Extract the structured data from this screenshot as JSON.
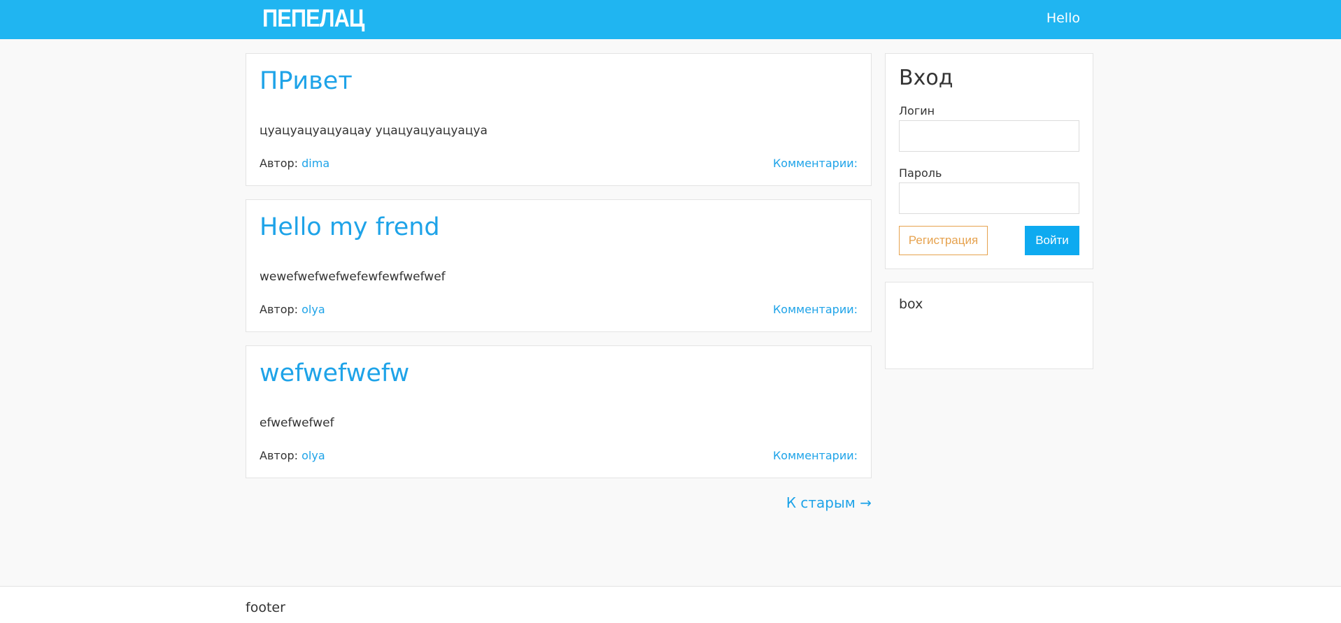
{
  "header": {
    "logo": "ПЕПЕЛАЦ",
    "user_link": "Hello"
  },
  "posts": [
    {
      "title": "ПРивет",
      "body": "цуацуацуацуацау уцацуацуацуацуа",
      "author_label": "Автор:",
      "author": "dima",
      "comments_label": "Комментарии:"
    },
    {
      "title": "Hello my frend",
      "body": "wewefwefwefwefewfewfwefwef",
      "author_label": "Автор:",
      "author": "olya",
      "comments_label": "Комментарии:"
    },
    {
      "title": "wefwefwefw",
      "body": "efwefwefwef",
      "author_label": "Автор:",
      "author": "olya",
      "comments_label": "Комментарии:"
    }
  ],
  "pagination": {
    "older_label": "К старым →"
  },
  "login": {
    "title": "Вход",
    "login_label": "Логин",
    "login_value": "",
    "password_label": "Пароль",
    "password_value": "",
    "register_label": "Регистрация",
    "submit_label": "Войти"
  },
  "box": {
    "text": "box"
  },
  "footer": {
    "text": "footer"
  },
  "colors": {
    "header_bg": "#20b5f1",
    "link": "#1ea3e8",
    "primary_button": "#0eaaf0",
    "register_button": "#e6a24e",
    "page_bg": "#f9f9f9"
  }
}
